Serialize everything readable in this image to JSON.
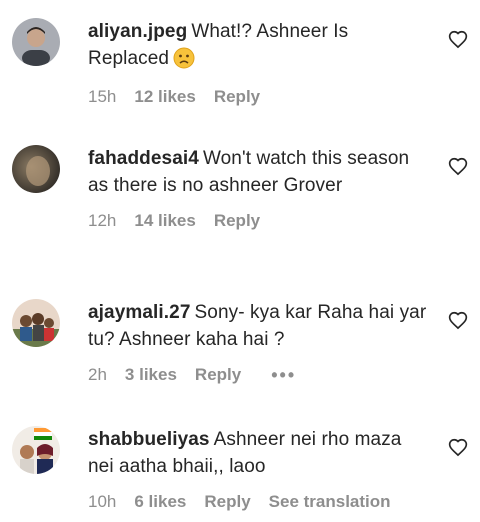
{
  "comments": [
    {
      "username": "aliyan.jpeg",
      "text": "What!? Ashneer Is Replaced",
      "emoji": "sad-face",
      "time": "15h",
      "likes": "12 likes",
      "reply": "Reply"
    },
    {
      "username": "fahaddesai4",
      "text": "Won't watch this season as there is no ashneer Grover",
      "time": "12h",
      "likes": "14 likes",
      "reply": "Reply"
    },
    {
      "username": "ajaymali.27",
      "text": "Sony- kya kar Raha hai yar tu? Ashneer kaha hai ?",
      "time": "2h",
      "likes": "3 likes",
      "reply": "Reply",
      "more": "•••"
    },
    {
      "username": "shabbueliyas",
      "text": "Ashneer nei rho maza nei aatha bhaii,, laoo",
      "time": "10h",
      "likes": "6 likes",
      "reply": "Reply",
      "translate": "See translation"
    }
  ],
  "icons": {
    "like": "heart-outline-icon",
    "avatar": "profile-picture"
  },
  "colors": {
    "text": "#262626",
    "meta": "#8e8e8e",
    "background": "#ffffff"
  }
}
